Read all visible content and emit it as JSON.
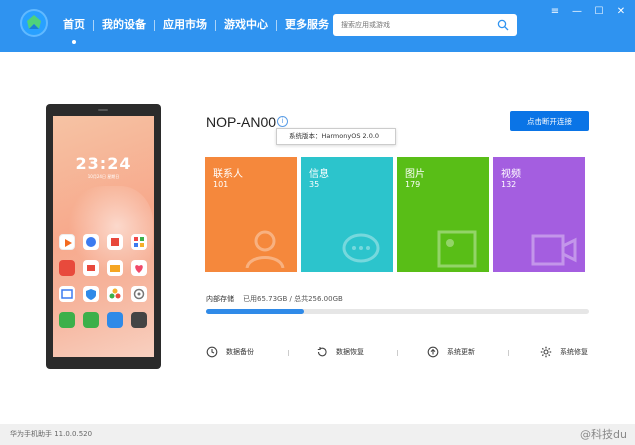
{
  "nav": {
    "items": [
      {
        "label": "首页",
        "active": true
      },
      {
        "label": "我的设备"
      },
      {
        "label": "应用市场"
      },
      {
        "label": "游戏中心"
      },
      {
        "label": "更多服务"
      }
    ]
  },
  "search": {
    "placeholder": "搜索应用或游戏"
  },
  "window_controls": {
    "menu": "≡",
    "minimize": "—",
    "maximize": "☐",
    "close": "✕"
  },
  "phone": {
    "time": "23:24",
    "date": "10月24日 星期日"
  },
  "device": {
    "name": "NOP-AN00",
    "info_symbol": "i",
    "tooltip": "系统版本：HarmonyOS 2.0.0",
    "disconnect_label": "点击断开连接"
  },
  "tiles": [
    {
      "label": "联系人",
      "count": "101",
      "color": "#f5883c",
      "icon": "contact-icon"
    },
    {
      "label": "信息",
      "count": "35",
      "color": "#2cc4cc",
      "icon": "message-icon"
    },
    {
      "label": "图片",
      "count": "179",
      "color": "#59be17",
      "icon": "picture-icon"
    },
    {
      "label": "视频",
      "count": "132",
      "color": "#a45ee0",
      "icon": "video-icon"
    }
  ],
  "storage": {
    "label": "内部存储",
    "value": "已用65.73GB / 总共256.00GB",
    "used_fraction": 0.2568
  },
  "actions": [
    {
      "label": "数据备份",
      "icon": "backup-icon"
    },
    {
      "label": "数据恢复",
      "icon": "restore-icon"
    },
    {
      "label": "系统更新",
      "icon": "update-icon"
    },
    {
      "label": "系统修复",
      "icon": "repair-icon"
    }
  ],
  "footer": {
    "version": "华为手机助手 11.0.0.520",
    "watermark": "@科技du"
  }
}
